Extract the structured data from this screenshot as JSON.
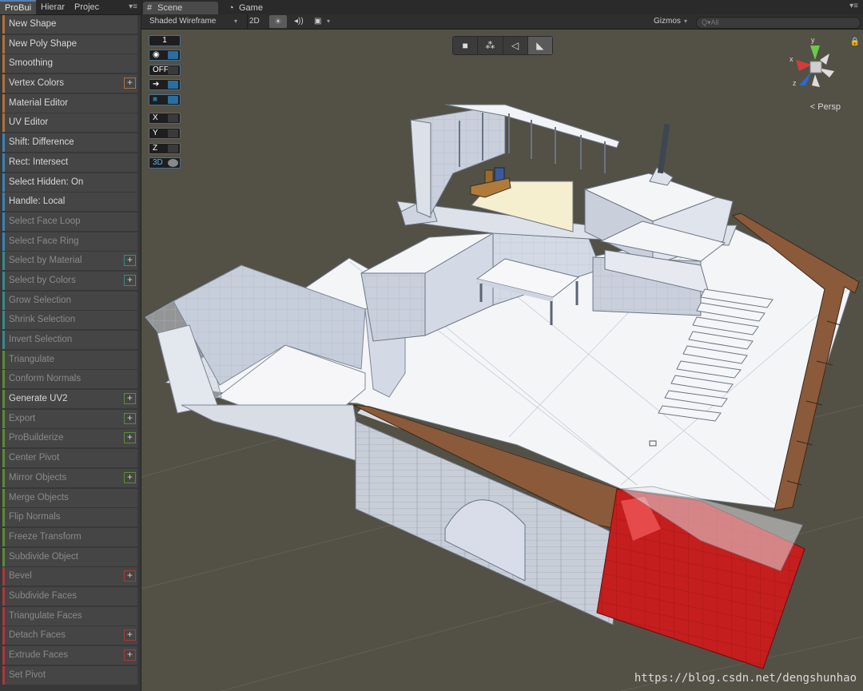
{
  "left_panel": {
    "tabs": [
      "ProBui",
      "Hierar",
      "Projec"
    ],
    "menu_icon": "panel-menu-icon",
    "tools": [
      {
        "label": "New Shape",
        "color": "#b0713f",
        "dim": false,
        "plus": false
      },
      {
        "label": "New Poly Shape",
        "color": "#b0713f",
        "dim": false,
        "plus": false
      },
      {
        "label": "Smoothing",
        "color": "#b0713f",
        "dim": false,
        "plus": false
      },
      {
        "label": "Vertex Colors",
        "color": "#b0713f",
        "dim": false,
        "plus": true
      },
      {
        "label": "Material Editor",
        "color": "#b0713f",
        "dim": false,
        "plus": false
      },
      {
        "label": "UV Editor",
        "color": "#b0713f",
        "dim": false,
        "plus": false
      },
      {
        "label": "Shift: Difference",
        "color": "#3c82b4",
        "dim": false,
        "plus": false
      },
      {
        "label": "Rect: Intersect",
        "color": "#3c82b4",
        "dim": false,
        "plus": false
      },
      {
        "label": "Select Hidden: On",
        "color": "#3c82b4",
        "dim": false,
        "plus": false
      },
      {
        "label": "Handle: Local",
        "color": "#3c82b4",
        "dim": false,
        "plus": false
      },
      {
        "label": "Select Face Loop",
        "color": "#3c82b4",
        "dim": true,
        "plus": false
      },
      {
        "label": "Select Face Ring",
        "color": "#3c82b4",
        "dim": true,
        "plus": false
      },
      {
        "label": "Select by Material",
        "color": "#3a8a8a",
        "dim": true,
        "plus": true
      },
      {
        "label": "Select by Colors",
        "color": "#3a8a8a",
        "dim": true,
        "plus": true
      },
      {
        "label": "Grow Selection",
        "color": "#3a8a8a",
        "dim": true,
        "plus": false
      },
      {
        "label": "Shrink Selection",
        "color": "#3a8a8a",
        "dim": true,
        "plus": false
      },
      {
        "label": "Invert Selection",
        "color": "#3a8a8a",
        "dim": true,
        "plus": false
      },
      {
        "label": "Triangulate",
        "color": "#5c8a3a",
        "dim": true,
        "plus": false
      },
      {
        "label": "Conform Normals",
        "color": "#5c8a3a",
        "dim": true,
        "plus": false
      },
      {
        "label": "Generate UV2",
        "color": "#5c8a3a",
        "dim": false,
        "plus": true
      },
      {
        "label": "Export",
        "color": "#5c8a3a",
        "dim": true,
        "plus": true
      },
      {
        "label": "ProBuilderize",
        "color": "#5c8a3a",
        "dim": true,
        "plus": true
      },
      {
        "label": "Center Pivot",
        "color": "#5c8a3a",
        "dim": true,
        "plus": false
      },
      {
        "label": "Mirror Objects",
        "color": "#5c8a3a",
        "dim": true,
        "plus": true
      },
      {
        "label": "Merge Objects",
        "color": "#5c8a3a",
        "dim": true,
        "plus": false
      },
      {
        "label": "Flip Normals",
        "color": "#5c8a3a",
        "dim": true,
        "plus": false
      },
      {
        "label": "Freeze Transform",
        "color": "#5c8a3a",
        "dim": true,
        "plus": false
      },
      {
        "label": "Subdivide Object",
        "color": "#5c8a3a",
        "dim": true,
        "plus": false
      },
      {
        "label": "Bevel",
        "color": "#a83a3a",
        "dim": true,
        "plus": true
      },
      {
        "label": "Subdivide Faces",
        "color": "#a83a3a",
        "dim": true,
        "plus": false
      },
      {
        "label": "Triangulate Faces",
        "color": "#a83a3a",
        "dim": true,
        "plus": false
      },
      {
        "label": "Detach Faces",
        "color": "#a83a3a",
        "dim": true,
        "plus": true
      },
      {
        "label": "Extrude Faces",
        "color": "#a83a3a",
        "dim": true,
        "plus": true
      },
      {
        "label": "Set Pivot",
        "color": "#a83a3a",
        "dim": true,
        "plus": false
      }
    ]
  },
  "scene_panel": {
    "tabs": [
      {
        "label": "Scene",
        "icon": "scene-grid-icon",
        "active": true
      },
      {
        "label": "Game",
        "icon": "game-pacman-icon",
        "active": false
      }
    ],
    "toolbar": {
      "draw_mode": "Shaded Wireframe",
      "mode_2d": "2D",
      "gizmos": "Gizmos",
      "search_placeholder": "Q▾All"
    },
    "handles": [
      "1",
      "",
      "OFF",
      "",
      "",
      "X",
      "Y",
      "Z",
      "3D"
    ],
    "select_modes": [
      "object-cube-icon",
      "vertex-icon",
      "edge-icon",
      "face-icon"
    ],
    "view_label": "Persp",
    "axis_labels": {
      "x": "x",
      "y": "y",
      "z": "z"
    }
  },
  "watermark": "https://blog.csdn.net/dengshunhao",
  "colors": {
    "viewport_bg": "#535046",
    "red_face": "#c41e1e",
    "wood": "#8a5a3a"
  }
}
